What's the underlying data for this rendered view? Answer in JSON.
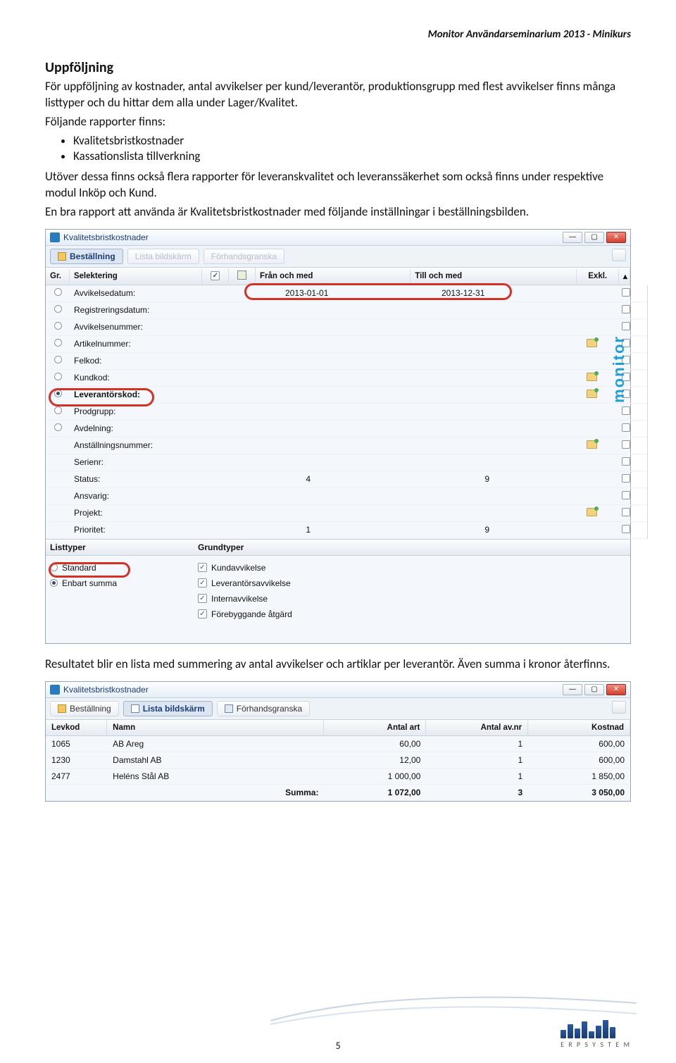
{
  "header": "Monitor Användarseminarium 2013 - Minikurs",
  "sec_uppfoljning": "Uppföljning",
  "p1": "För uppföljning av kostnader, antal avvikelser per kund/leverantör, produktionsgrupp med flest avvikelser finns många listtyper och du hittar dem alla under Lager/Kvalitet.",
  "p2": "Följande rapporter finns:",
  "bul": [
    "Kvalitetsbristkostnader",
    "Kassationslista tillverkning"
  ],
  "p3": "Utöver dessa finns också flera rapporter för leveranskvalitet och leveranssäkerhet som också finns under respektive modul Inköp och Kund.",
  "p4": "En bra rapport att använda är Kvalitetsbristkostnader med följande inställningar i beställningsbilden.",
  "win1": {
    "title": "Kvalitetsbristkostnader",
    "tabs": [
      "Beställning",
      "Lista bildskärm",
      "Förhandsgranska"
    ],
    "hdr": {
      "gr": "Gr.",
      "sel": "Selektering",
      "fran": "Från och med",
      "till": "Till och med",
      "exkl": "Exkl."
    },
    "rows": [
      {
        "label": "Avvikelsedatum:",
        "radio": true,
        "fr": "2013-01-01",
        "to": "2013-12-31"
      },
      {
        "label": "Registreringsdatum:",
        "radio": true
      },
      {
        "label": "Avvikelsenummer:",
        "radio": true
      },
      {
        "label": "Artikelnummer:",
        "radio": true,
        "lookup": true
      },
      {
        "label": "Felkod:",
        "radio": true
      },
      {
        "label": "Kundkod:",
        "radio": true,
        "lookup": true
      },
      {
        "label": "Leverantörskod:",
        "radio": true,
        "on": true,
        "bold": true,
        "lookup": true
      },
      {
        "label": "Prodgrupp:",
        "radio": true
      },
      {
        "label": "Avdelning:",
        "radio": true
      },
      {
        "label": "Anställningsnummer:",
        "lookup": true
      },
      {
        "label": "Serienr:"
      },
      {
        "label": "Status:",
        "fr": "4",
        "to": "9",
        "alignNum": true
      },
      {
        "label": "Ansvarig:"
      },
      {
        "label": "Projekt:",
        "lookup": true
      },
      {
        "label": "Prioritet:",
        "fr": "1",
        "to": "9",
        "alignNum": true
      }
    ],
    "sub_left": "Listtyper",
    "sub_right": "Grundtyper",
    "listleft": [
      {
        "label": "Standard",
        "on": false
      },
      {
        "label": "Enbart summa",
        "on": true
      }
    ],
    "listright": [
      "Kundavvikelse",
      "Leverantörsavvikelse",
      "Internavvikelse",
      "Förebyggande åtgärd"
    ],
    "brand": "monitor"
  },
  "p5": "Resultatet blir en lista med summering av antal avvikelser och artiklar per leverantör. Även summa i kronor återfinns.",
  "win2": {
    "title": "Kvalitetsbristkostnader",
    "tabs": [
      "Beställning",
      "Lista bildskärm",
      "Förhandsgranska"
    ],
    "hdr": {
      "lev": "Levkod",
      "namn": "Namn",
      "art": "Antal art",
      "av": "Antal av.nr",
      "kost": "Kostnad"
    },
    "rows": [
      {
        "lev": "1065",
        "namn": "AB Areg",
        "art": "60,00",
        "av": "1",
        "kost": "600,00"
      },
      {
        "lev": "1230",
        "namn": "Damstahl AB",
        "art": "12,00",
        "av": "1",
        "kost": "600,00"
      },
      {
        "lev": "2477",
        "namn": "Heléns Stål AB",
        "art": "1 000,00",
        "av": "1",
        "kost": "1 850,00"
      }
    ],
    "sum": {
      "namn": "Summa:",
      "art": "1 072,00",
      "av": "3",
      "kost": "3 050,00"
    }
  },
  "pagenum": "5",
  "logotext": "E R P   S Y S T E M"
}
